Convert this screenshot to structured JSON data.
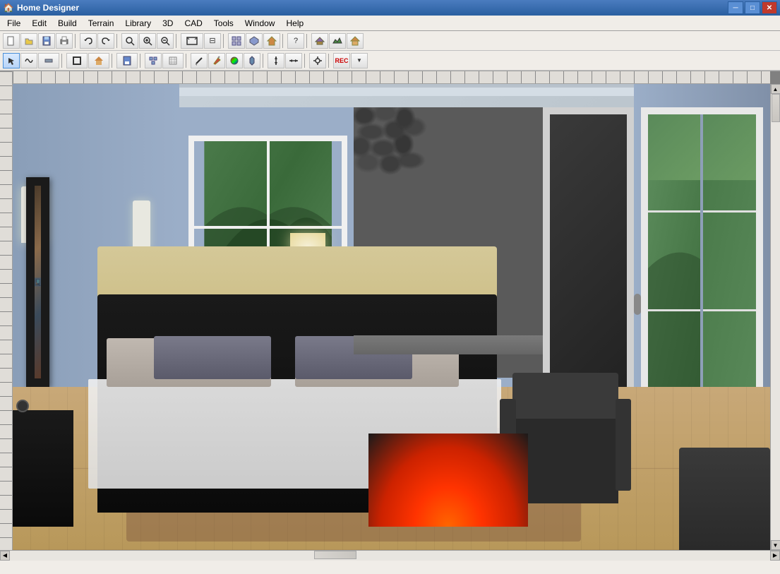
{
  "window": {
    "title": "Home Designer",
    "icon": "🏠"
  },
  "titlebar": {
    "minimize": "─",
    "maximize": "□",
    "close": "✕"
  },
  "menu": {
    "items": [
      "File",
      "Edit",
      "Build",
      "Terrain",
      "Library",
      "3D",
      "CAD",
      "Tools",
      "Window",
      "Help"
    ]
  },
  "toolbar1": {
    "buttons": [
      {
        "icon": "📄",
        "name": "new",
        "tooltip": "New"
      },
      {
        "icon": "📂",
        "name": "open",
        "tooltip": "Open"
      },
      {
        "icon": "💾",
        "name": "save",
        "tooltip": "Save"
      },
      {
        "icon": "🖨",
        "name": "print",
        "tooltip": "Print"
      },
      {
        "icon": "↩",
        "name": "undo",
        "tooltip": "Undo"
      },
      {
        "icon": "↪",
        "name": "redo",
        "tooltip": "Redo"
      },
      {
        "icon": "🔍",
        "name": "zoom",
        "tooltip": "Zoom"
      },
      {
        "icon": "+",
        "name": "zoomin",
        "tooltip": "Zoom In"
      },
      {
        "icon": "-",
        "name": "zoomout",
        "tooltip": "Zoom Out"
      },
      {
        "icon": "⊞",
        "name": "fit",
        "tooltip": "Fit"
      },
      {
        "icon": "⊟",
        "name": "fill",
        "tooltip": "Fill"
      }
    ]
  },
  "toolbar2": {
    "buttons": [
      {
        "icon": "↖",
        "name": "select",
        "tooltip": "Select"
      },
      {
        "icon": "～",
        "name": "polyline",
        "tooltip": "Polyline"
      },
      {
        "icon": "⊢",
        "name": "wall",
        "tooltip": "Wall"
      },
      {
        "icon": "▦",
        "name": "room",
        "tooltip": "Room"
      },
      {
        "icon": "🏠",
        "name": "house",
        "tooltip": "House"
      },
      {
        "icon": "💾",
        "name": "save2",
        "tooltip": "Save"
      },
      {
        "icon": "⊡",
        "name": "component",
        "tooltip": "Component"
      },
      {
        "icon": "⊞",
        "name": "grid",
        "tooltip": "Grid"
      },
      {
        "icon": "▷",
        "name": "terrain",
        "tooltip": "Terrain"
      },
      {
        "icon": "✏",
        "name": "draw",
        "tooltip": "Draw"
      },
      {
        "icon": "🎨",
        "name": "paint",
        "tooltip": "Paint"
      },
      {
        "icon": "⊕",
        "name": "add",
        "tooltip": "Add"
      },
      {
        "icon": "↕",
        "name": "arrow",
        "tooltip": "Arrow"
      },
      {
        "icon": "⊞",
        "name": "snap",
        "tooltip": "Snap"
      },
      {
        "icon": "REC",
        "name": "record",
        "tooltip": "Record"
      }
    ]
  },
  "statusbar": {
    "text": ""
  }
}
